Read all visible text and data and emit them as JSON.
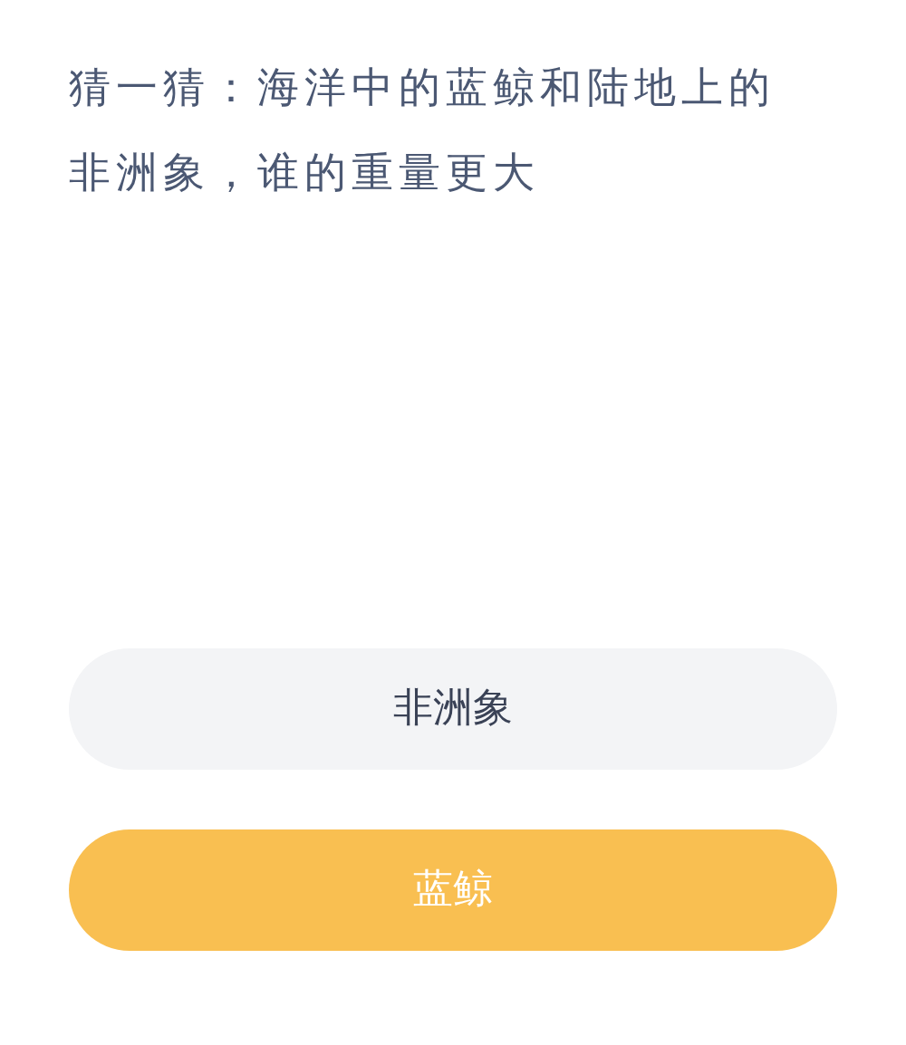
{
  "question": "猜一猜：海洋中的蓝鲸和陆地上的非洲象，谁的重量更大",
  "options": [
    {
      "label": "非洲象",
      "selected": false
    },
    {
      "label": "蓝鲸",
      "selected": true
    }
  ]
}
